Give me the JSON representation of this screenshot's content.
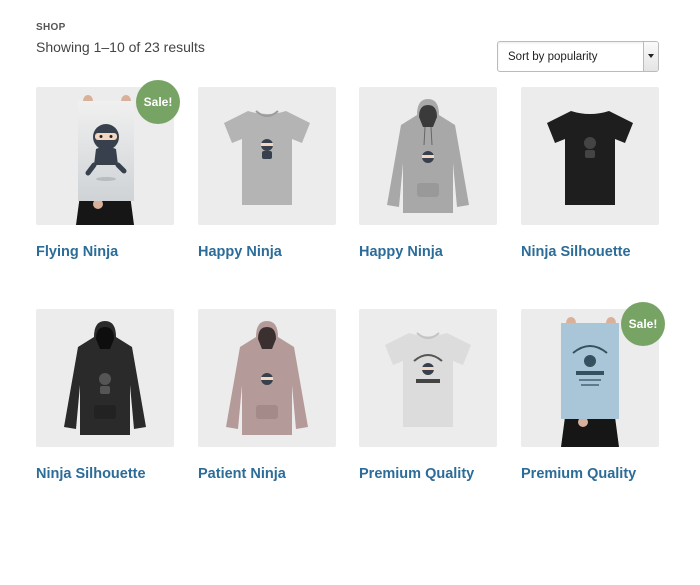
{
  "breadcrumb": "SHOP",
  "result_count": "Showing 1–10 of 23 results",
  "sort": {
    "selected": "Sort by popularity"
  },
  "sale_label": "Sale!",
  "products": [
    {
      "name": "Flying Ninja",
      "image": "poster-ninja-icon",
      "on_sale": true
    },
    {
      "name": "Happy Ninja",
      "image": "tshirt-icon",
      "on_sale": false
    },
    {
      "name": "Happy Ninja",
      "image": "hoodie-icon",
      "on_sale": false
    },
    {
      "name": "Ninja Silhouette",
      "image": "tshirt-icon",
      "on_sale": false
    },
    {
      "name": "Ninja Silhouette",
      "image": "hoodie-icon",
      "on_sale": false
    },
    {
      "name": "Patient Ninja",
      "image": "hoodie-icon",
      "on_sale": false
    },
    {
      "name": "Premium Quality",
      "image": "tshirt-icon",
      "on_sale": false
    },
    {
      "name": "Premium Quality",
      "image": "poster-woo-icon",
      "on_sale": true
    }
  ],
  "colors": {
    "link": "#2c6c98",
    "sale_badge": "#77a464",
    "thumb_bg": "#ececec",
    "tshirt_grey": "#b4b4b4",
    "tshirt_black": "#1e1e1e",
    "hoodie_grey": "#a8a8a8",
    "hoodie_black": "#2a2a2a",
    "hoodie_pink": "#b49a98",
    "tshirt_white": "#dcdcdc",
    "poster_blue": "#a9c6d8"
  }
}
